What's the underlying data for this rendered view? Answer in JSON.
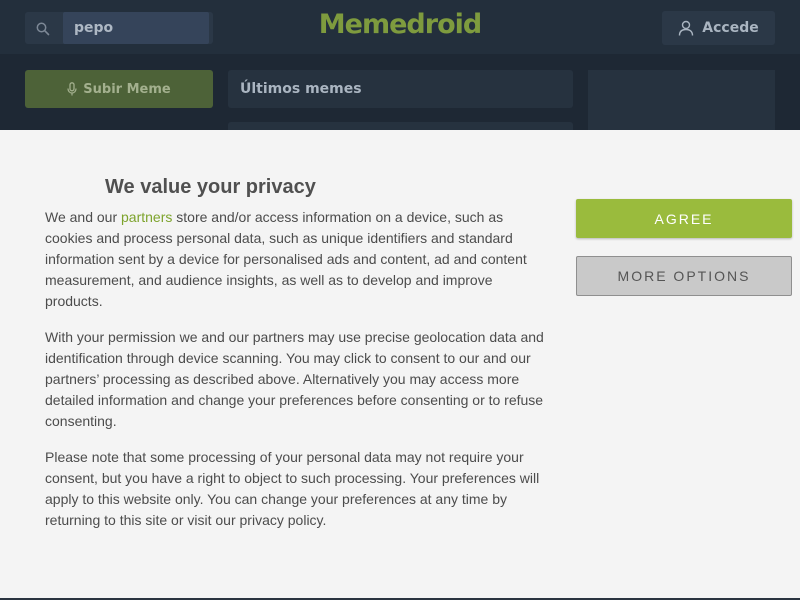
{
  "header": {
    "search_value": "pepo",
    "logo": "Memedroid",
    "login_label": "Accede",
    "icons": [
      "search-icon",
      "user-icon"
    ]
  },
  "main": {
    "upload_label": "Subir Meme",
    "upload_icon": "microphone-icon",
    "section_title": "Últimos memes"
  },
  "consent": {
    "title": "We value your privacy",
    "p1_before": "We and our ",
    "p1_link": "partners",
    "p1_after": " store and/or access information on a device, such as cookies and process personal data, such as unique identifiers and standard information sent by a device for personalised ads and content, ad and content measurement, and audience insights, as well as to develop and improve products.",
    "p2": "With your permission we and our partners may use precise geolocation data and identification through device scanning. You may click to consent to our and our partners’ processing as described above. Alternatively you may access more detailed information and change your preferences before consenting or to refuse consenting.",
    "p3": "Please note that some processing of your personal data may not require your consent, but you have a right to object to such processing. Your preferences will apply to this website only. You can change your preferences at any time by returning to this site or visit our privacy policy.",
    "agree_label": "AGREE",
    "more_label": "MORE OPTIONS"
  },
  "colors": {
    "brand_green": "#7e9b3e",
    "agree_green": "#9abb3d",
    "link_green": "#7da32c",
    "header_bg": "#232f3c"
  }
}
